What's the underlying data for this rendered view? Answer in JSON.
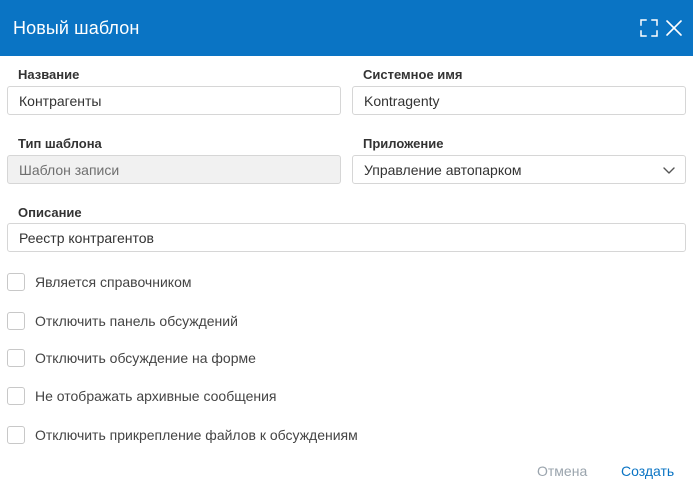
{
  "dialog": {
    "title": "Новый шаблон"
  },
  "form": {
    "name": {
      "label": "Название",
      "value": "Контрагенты"
    },
    "system_name": {
      "label": "Системное имя",
      "value": "Kontragenty"
    },
    "template_type": {
      "label": "Тип шаблона",
      "value": "Шаблон записи"
    },
    "application": {
      "label": "Приложение",
      "value": "Управление автопарком"
    },
    "description": {
      "label": "Описание",
      "value": "Реестр контрагентов"
    }
  },
  "checkboxes": [
    {
      "label": "Является справочником",
      "checked": false
    },
    {
      "label": "Отключить панель обсуждений",
      "checked": false
    },
    {
      "label": "Отключить обсуждение на форме",
      "checked": false
    },
    {
      "label": "Не отображать архивные сообщения",
      "checked": false
    },
    {
      "label": "Отключить прикрепление файлов к обсуждениям",
      "checked": false
    }
  ],
  "footer": {
    "cancel_label": "Отмена",
    "create_label": "Создать"
  },
  "colors": {
    "header_bg": "#0a74c4",
    "primary_link": "#0a74c4",
    "muted_link": "#9aa4ad"
  },
  "icons": {
    "expand": "expand-icon",
    "close": "close-icon",
    "dropdown": "chevron-down-icon"
  }
}
